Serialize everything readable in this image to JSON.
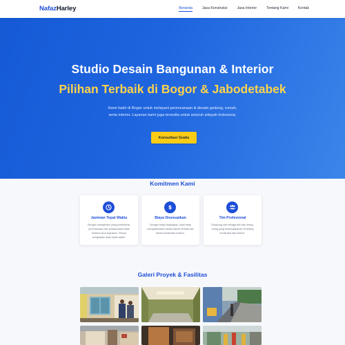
{
  "navbar": {
    "brand_part1": "Nafaz",
    "brand_part2": "Harley",
    "menu": [
      {
        "label": "Beranda"
      },
      {
        "label": "Jasa Konstruksi"
      },
      {
        "label": "Jasa Interior"
      },
      {
        "label": "Tentang Kami"
      },
      {
        "label": "Kontak"
      }
    ]
  },
  "hero": {
    "title": "Studio Desain Bangunan & Interior",
    "subtitle": "Pilihan Terbaik di Bogor & Jabodetabek",
    "description": "Kami hadir di Bogor untuk melayani perencanaan & desain gedung, rumah, serta interior. Layanan kami juga tersedia untuk seluruh wilayah Indonesia.",
    "cta_label": "Konsultasi Gratis"
  },
  "commitment": {
    "title": "Komitmen Kami",
    "cards": [
      {
        "icon": "clock-icon",
        "title": "Jaminan Tepat Waktu",
        "text": "Dengan manajemen yang profesional, perencanaan dan pelaksanaan tidak berlarut-larut lagi kami. Semua pengerjaan akan tepat waktu."
      },
      {
        "icon": "dollar-icon",
        "title": "Biaya Disesuaikan",
        "text": "Dengan biaya terjangkau, kami tetap mengutamakan bahan-bahan terbaik dan teknik konstruksi modern."
      },
      {
        "icon": "team-icon",
        "title": "Tim Profesional",
        "text": "Didukung oleh tenaga ahli dan orang-orang yang berpengalaman di bidang konstruksi dan interior."
      }
    ]
  },
  "gallery": {
    "title": "Galeri Proyek & Fasilitas"
  },
  "colors": {
    "primary": "#1d4ed8",
    "accent": "#facc15",
    "hero_gradient_start": "#1559d6",
    "hero_gradient_end": "#3b85ea"
  }
}
